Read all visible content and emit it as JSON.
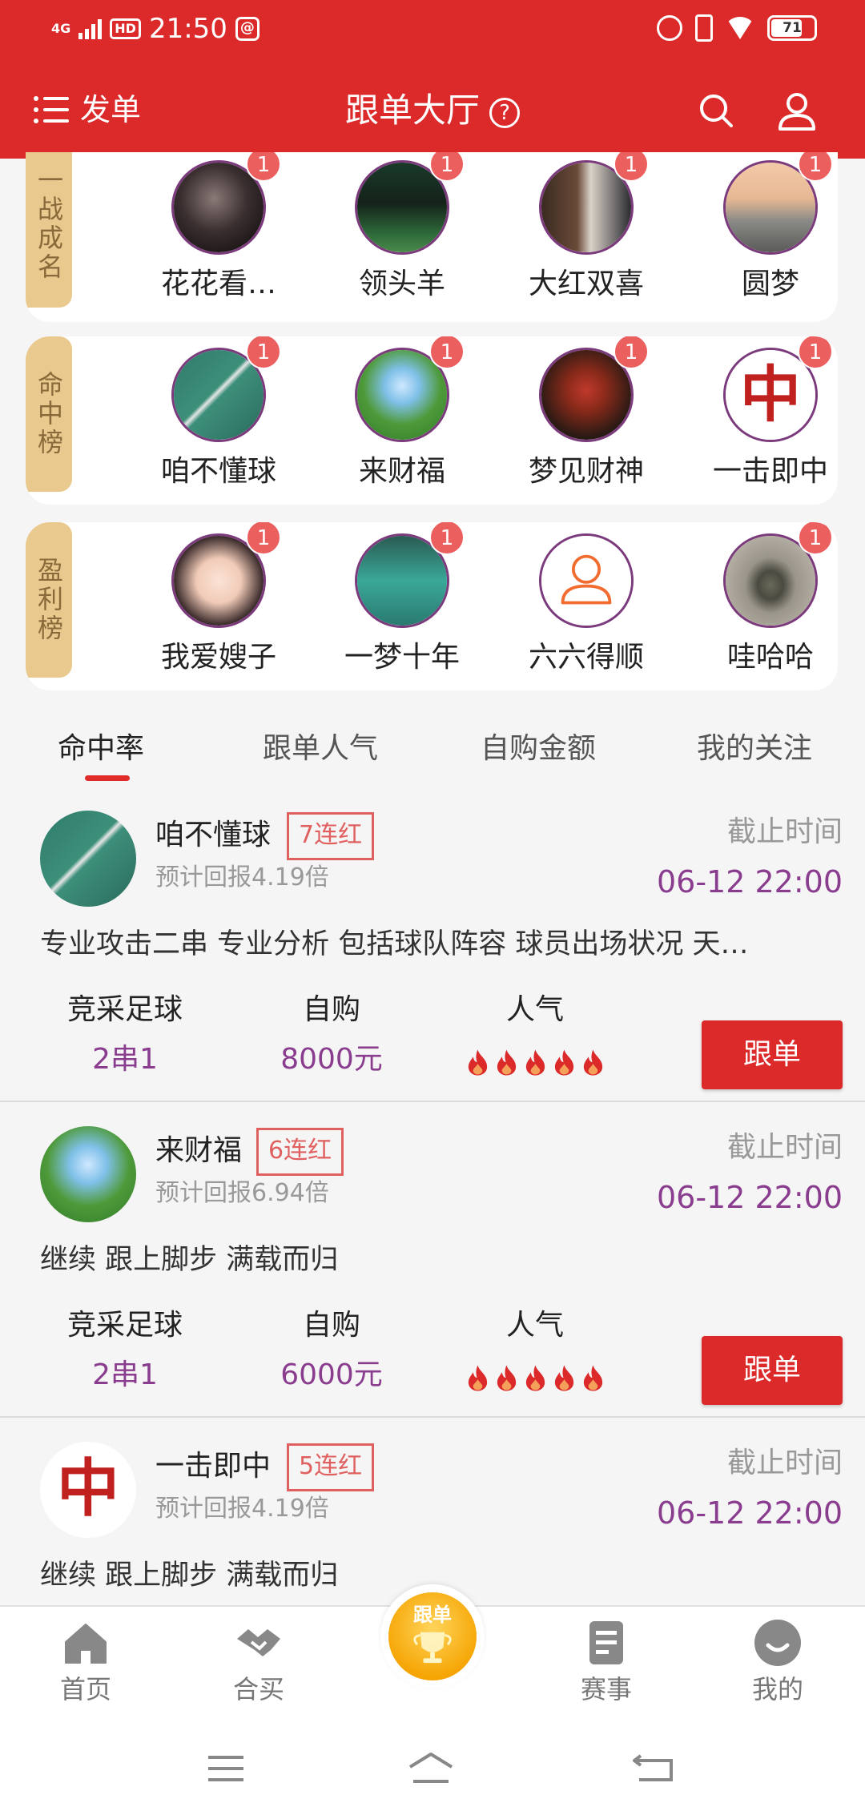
{
  "status_bar": {
    "network": "4G",
    "hd": "HD",
    "time": "21:50",
    "battery": "71"
  },
  "header": {
    "menu_label": "发单",
    "title": "跟单大厅"
  },
  "boards": [
    {
      "tag": "一战成名",
      "entries": [
        {
          "name": "花花看…",
          "badge": "1"
        },
        {
          "name": "领头羊",
          "badge": "1"
        },
        {
          "name": "大红双喜",
          "badge": "1"
        },
        {
          "name": "圆梦",
          "badge": "1"
        }
      ]
    },
    {
      "tag": "命中榜",
      "entries": [
        {
          "name": "咱不懂球",
          "badge": "1"
        },
        {
          "name": "来财福",
          "badge": "1"
        },
        {
          "name": "梦见财神",
          "badge": "1"
        },
        {
          "name": "一击即中",
          "badge": "1"
        }
      ]
    },
    {
      "tag": "盈利榜",
      "entries": [
        {
          "name": "我爱嫂子",
          "badge": "1"
        },
        {
          "name": "一梦十年",
          "badge": "1"
        },
        {
          "name": "六六得顺",
          "badge": ""
        },
        {
          "name": "哇哈哈",
          "badge": "1"
        }
      ]
    }
  ],
  "tabs": [
    "命中率",
    "跟单人气",
    "自购金额",
    "我的关注"
  ],
  "cards": [
    {
      "name": "咱不懂球",
      "streak": "7连红",
      "return": "预计回报4.19倍",
      "deadline_label": "截止时间",
      "deadline": "06-12 22:00",
      "desc": "专业攻击二串 专业分析 包括球队阵容 球员出场状况 天…",
      "type_label": "竞采足球",
      "type_value": "2串1",
      "self_label": "自购",
      "self_value": "8000元",
      "pop_label": "人气",
      "popularity": 5,
      "button": "跟单"
    },
    {
      "name": "来财福",
      "streak": "6连红",
      "return": "预计回报6.94倍",
      "deadline_label": "截止时间",
      "deadline": "06-12 22:00",
      "desc": "继续 跟上脚步 满载而归",
      "type_label": "竞采足球",
      "type_value": "2串1",
      "self_label": "自购",
      "self_value": "6000元",
      "pop_label": "人气",
      "popularity": 5,
      "button": "跟单"
    },
    {
      "name": "一击即中",
      "streak": "5连红",
      "return": "预计回报4.19倍",
      "deadline_label": "截止时间",
      "deadline": "06-12 22:00",
      "desc": "继续 跟上脚步 满载而归"
    }
  ],
  "fab_label": "跟单",
  "bottom_nav": [
    "首页",
    "合买",
    "赛事",
    "我的"
  ],
  "colors": {
    "primary_red": "#dc2a2b",
    "purple": "#8a3c8e",
    "tag_gold": "#e9c98e",
    "badge_red": "#ec5f5f"
  }
}
